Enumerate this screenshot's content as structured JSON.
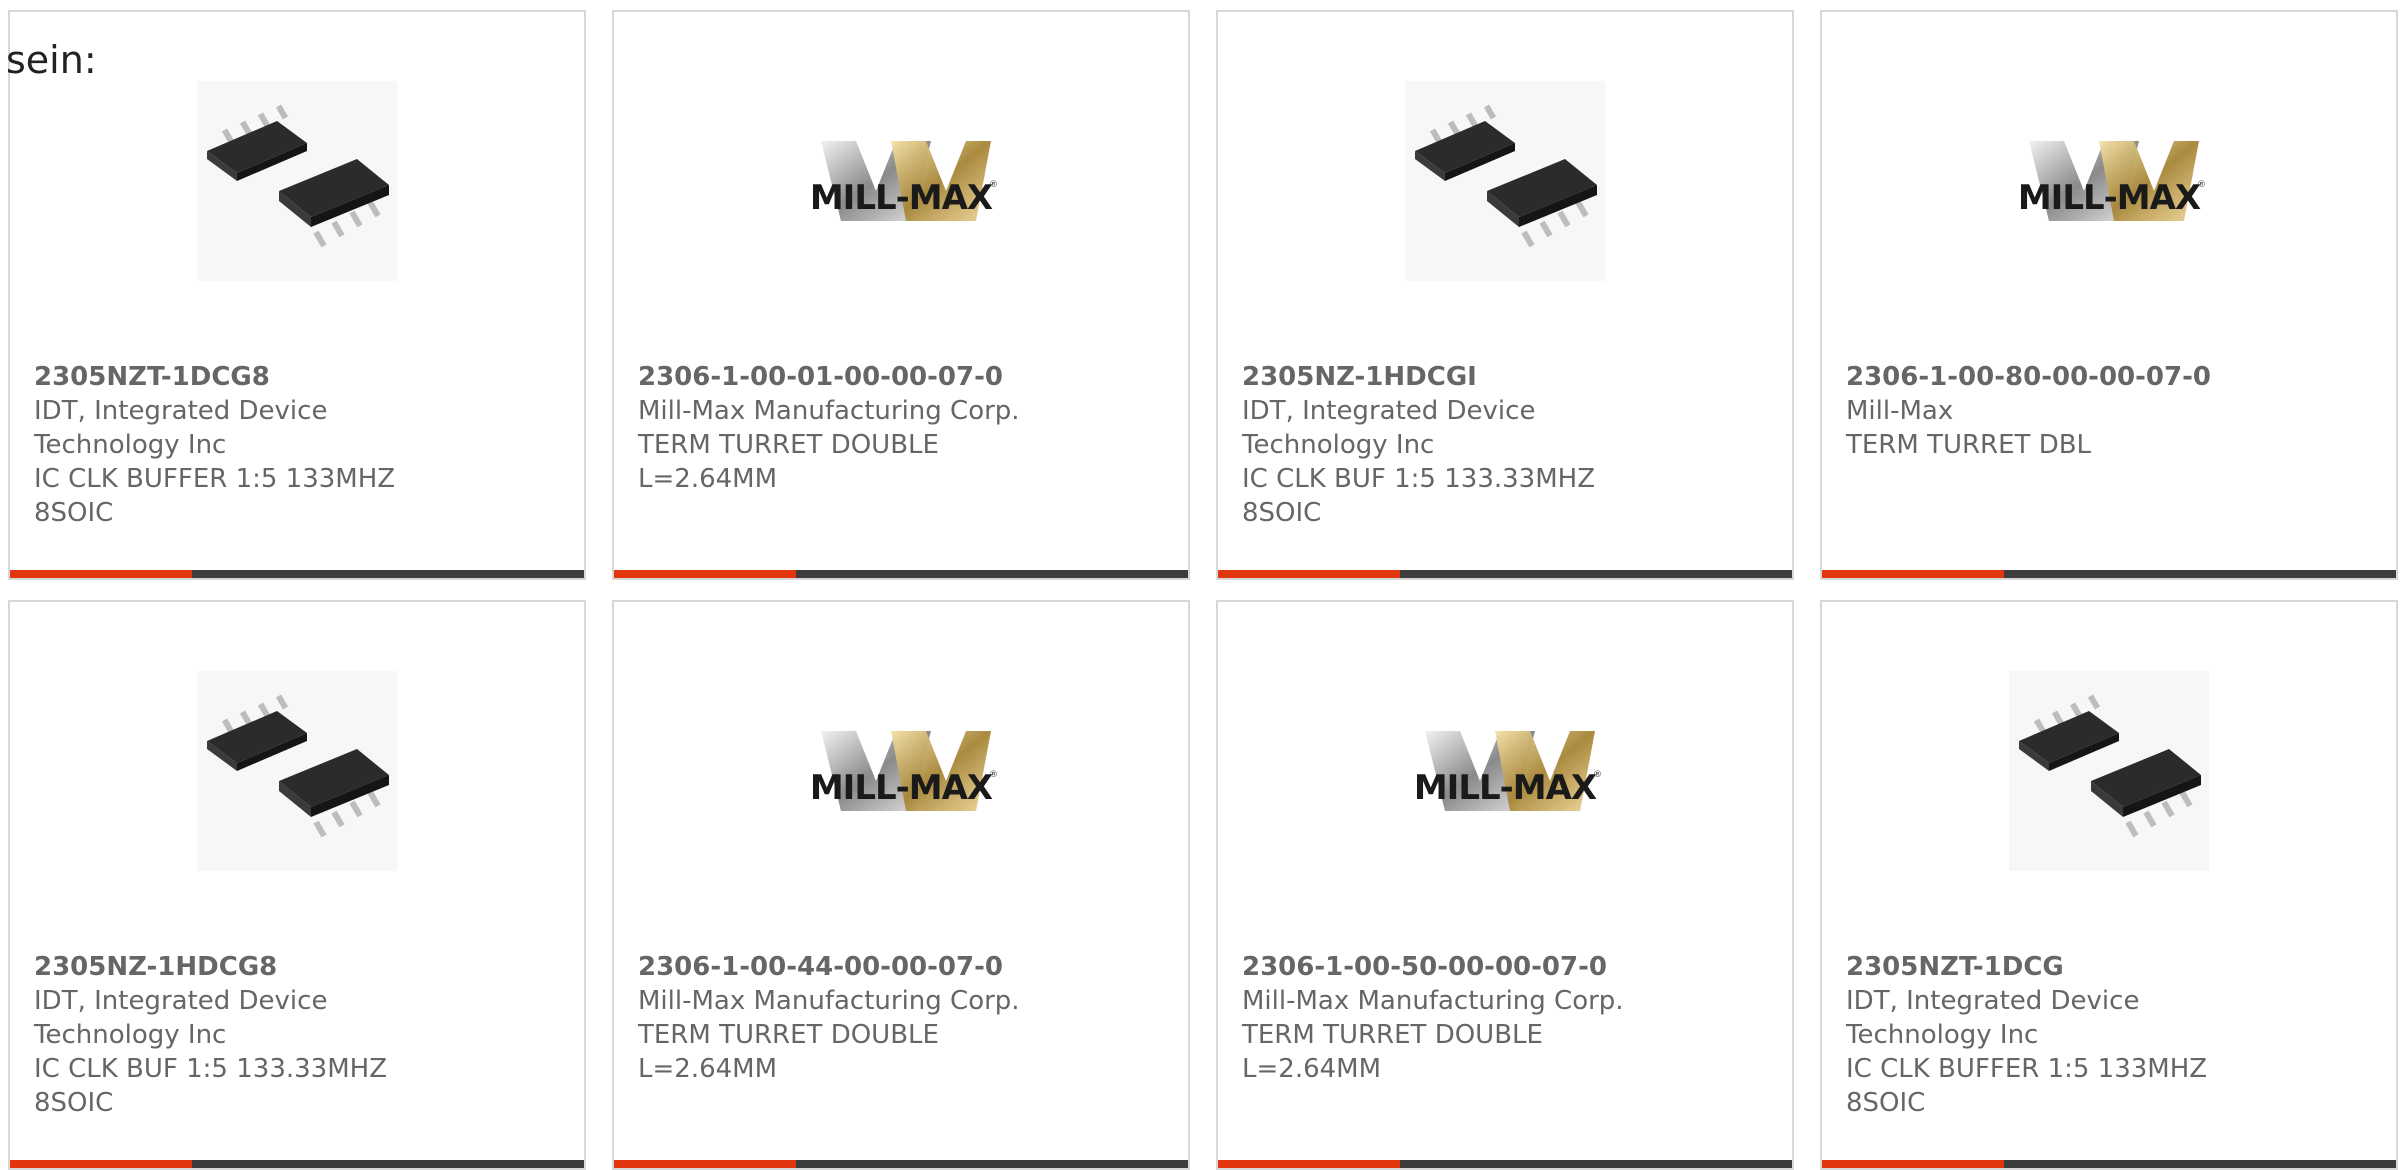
{
  "fragment_text": "sein:",
  "colors": {
    "accent": "#e2360e",
    "bar": "#3d3d3d",
    "text": "#666666",
    "border": "#d7d7d7"
  },
  "cards": [
    {
      "image": "ic-chip-image",
      "part": "2305NZT-1DCG8",
      "lines": [
        "IDT, Integrated Device",
        "Technology Inc",
        "IC CLK BUFFER 1:5 133MHZ",
        "8SOIC"
      ]
    },
    {
      "image": "mill-max-logo",
      "part": "2306-1-00-01-00-00-07-0",
      "lines": [
        "Mill-Max Manufacturing Corp.",
        "TERM TURRET DOUBLE",
        "L=2.64MM"
      ]
    },
    {
      "image": "ic-chip-image",
      "part": "2305NZ-1HDCGI",
      "lines": [
        "IDT, Integrated Device",
        "Technology Inc",
        "IC CLK BUF 1:5 133.33MHZ",
        "8SOIC"
      ]
    },
    {
      "image": "mill-max-logo",
      "part": "2306-1-00-80-00-00-07-0",
      "lines": [
        "Mill-Max",
        "TERM TURRET DBL"
      ]
    },
    {
      "image": "ic-chip-image",
      "part": "2305NZ-1HDCG8",
      "lines": [
        "IDT, Integrated Device",
        "Technology Inc",
        "IC CLK BUF 1:5 133.33MHZ",
        "8SOIC"
      ]
    },
    {
      "image": "mill-max-logo",
      "part": "2306-1-00-44-00-00-07-0",
      "lines": [
        "Mill-Max Manufacturing Corp.",
        "TERM TURRET DOUBLE",
        "L=2.64MM"
      ]
    },
    {
      "image": "mill-max-logo",
      "part": "2306-1-00-50-00-00-07-0",
      "lines": [
        "Mill-Max Manufacturing Corp.",
        "TERM TURRET DOUBLE",
        "L=2.64MM"
      ]
    },
    {
      "image": "ic-chip-image",
      "part": "2305NZT-1DCG",
      "lines": [
        "IDT, Integrated Device",
        "Technology Inc",
        "IC CLK BUFFER 1:5 133MHZ",
        "8SOIC"
      ]
    }
  ]
}
